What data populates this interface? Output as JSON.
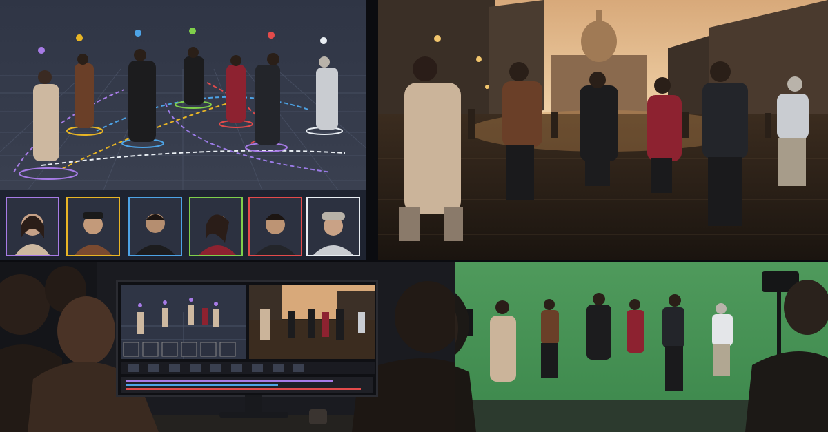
{
  "panels": {
    "planning": {
      "portraits": 6
    },
    "city": {},
    "editing": {},
    "greenscreen": {}
  },
  "colors": {
    "marker_purple": "#a77be6",
    "marker_yellow": "#e8b525",
    "marker_blue": "#4da3e6",
    "marker_green": "#7fcf4b",
    "marker_red": "#e34b4b",
    "marker_white": "#e9eef3",
    "greenscreen": "#4f9a5c"
  },
  "icons": [
    "map-pin-icon"
  ]
}
